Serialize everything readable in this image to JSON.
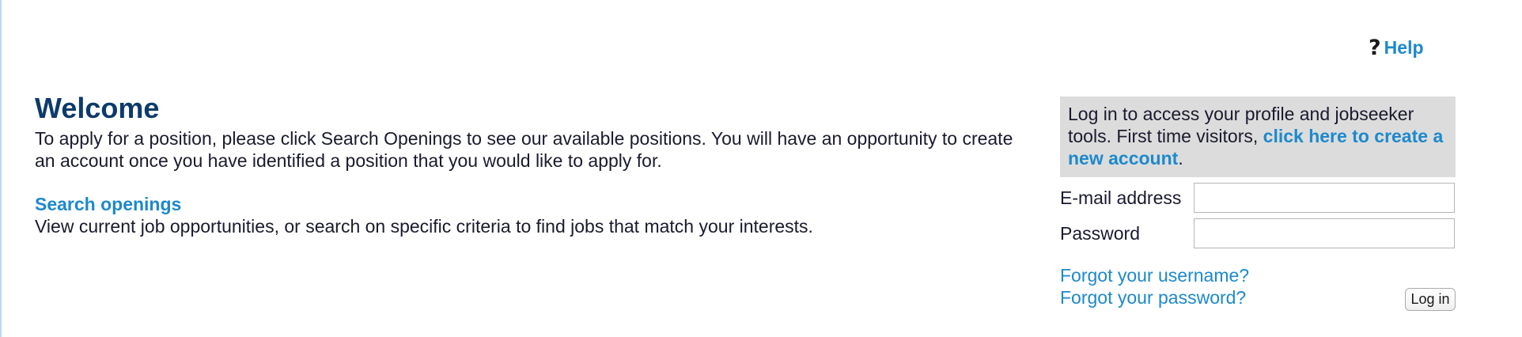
{
  "header": {
    "help_icon_glyph": "?",
    "help_label": "Help"
  },
  "main": {
    "title": "Welcome",
    "intro": "To apply for a position, please click Search Openings to see our available positions. You will have an opportunity to create an account once you have identified a position that you would like to apply for.",
    "search_link": "Search openings",
    "search_description": "View current job opportunities, or search on specific criteria to find jobs that match your interests."
  },
  "login": {
    "info_text": "Log in to access your profile and jobseeker tools. First time visitors, ",
    "create_account_link": "click here to create a new account",
    "info_suffix": ".",
    "email_label": "E-mail address",
    "email_value": "",
    "password_label": "Password",
    "password_value": "",
    "forgot_username": "Forgot your username?",
    "forgot_password": "Forgot your password?",
    "login_button": "Log in"
  },
  "colors": {
    "heading": "#0d3a6b",
    "link": "#1d89cc",
    "panel_background": "#dcdcdc"
  }
}
